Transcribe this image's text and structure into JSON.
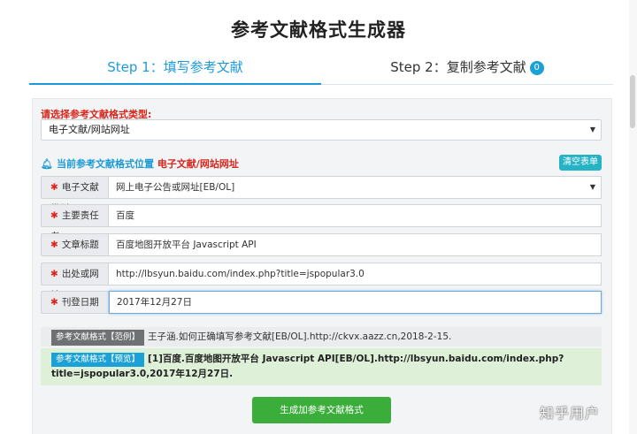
{
  "page_title": "参考文献格式生成器",
  "tabs": [
    {
      "label": "Step 1：填写参考文献"
    },
    {
      "label": "Step 2：复制参考文献",
      "badge": "0"
    }
  ],
  "type_select": {
    "label": "请选择参考文献格式类型:",
    "value": "电子文献/网站网址"
  },
  "current_position": {
    "prefix": "当前参考文献格式位置",
    "value": "电子文献/网站网址"
  },
  "clear_button": "清空表单",
  "fields": [
    {
      "label": "电子文献类型",
      "value": "网上电子公告或网址[EB/OL]"
    },
    {
      "label": "主要责任者",
      "value": "百度"
    },
    {
      "label": "文章标题",
      "value": "百度地图开放平台 Javascript API"
    },
    {
      "label": "出处或网址",
      "value": "http://lbsyun.baidu.com/index.php?title=jspopular3.0"
    },
    {
      "label": "刊登日期",
      "value": "2017年12月27日"
    }
  ],
  "example": {
    "tag": "参考文献格式【范例】",
    "text": "王子涵.如何正确填写参考文献[EB/OL].http://ckvx.aazz.cn,2018-2-15."
  },
  "preview": {
    "tag": "参考文献格式【预览】",
    "text": "[1]百度.百度地图开放平台 Javascript API[EB/OL].http://lbsyun.baidu.com/index.php?title=jspopular3.0,2017年12月27日."
  },
  "generate_button": "生成加参考文献格式",
  "watermark": "知乎用户",
  "colors": {
    "accent": "#1e9bd7",
    "required": "#d9261c",
    "generate": "#3aad3a",
    "preview_bg": "#def0d8"
  }
}
